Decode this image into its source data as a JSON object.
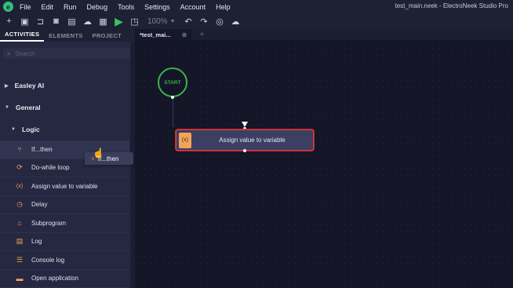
{
  "menu": {
    "logo_glyph": "e",
    "items": [
      "File",
      "Edit",
      "Run",
      "Debug",
      "Tools",
      "Settings",
      "Account",
      "Help"
    ],
    "window_title": "test_main.neek - ElectroNeek Studio Pro"
  },
  "toolbar": {
    "zoom_value": "100%",
    "icons": [
      "plus-icon",
      "save-icon",
      "folder-open-icon",
      "save-icon",
      "save-as-icon",
      "cloud-upload-icon",
      "ai-icon",
      "play-icon",
      "undo-icon",
      "redo-icon",
      "globe-icon",
      "cloud-icon"
    ]
  },
  "left_panel": {
    "tabs": [
      "ACTIVITIES",
      "ELEMENTS",
      "PROJECT"
    ],
    "active_tab": "ACTIVITIES",
    "search_placeholder": "Search",
    "groups": [
      {
        "label": "Easley AI",
        "expanded": false
      },
      {
        "label": "General",
        "expanded": true
      }
    ],
    "subgroup": {
      "label": "Logic",
      "expanded": true
    },
    "activities": [
      {
        "label": "If...then",
        "icon": "branch-icon",
        "glyph": "⑂"
      },
      {
        "label": "Do-while loop",
        "icon": "loop-icon",
        "glyph": "⟳"
      },
      {
        "label": "Assign value to variable",
        "icon": "variable-icon",
        "glyph": "(x)"
      },
      {
        "label": "Delay",
        "icon": "clock-icon",
        "glyph": "◷"
      },
      {
        "label": "Subprogram",
        "icon": "subprogram-icon",
        "glyph": "⌂"
      },
      {
        "label": "Log",
        "icon": "log-icon",
        "glyph": "▤"
      },
      {
        "label": "Console log",
        "icon": "console-icon",
        "glyph": "☰"
      },
      {
        "label": "Open application",
        "icon": "window-icon",
        "glyph": "▬"
      }
    ]
  },
  "drag_ghost": {
    "label": "If...then",
    "glyph": "⑂"
  },
  "editor": {
    "tab_label": "*test_mai...",
    "canvas": {
      "start_label": "START",
      "block_label": "Assign value to variable",
      "block_icon_glyph": "(x)"
    }
  },
  "colors": {
    "accent_orange": "#f2a45c",
    "start_green": "#3fb24a",
    "error_red": "#e5383b",
    "play_green": "#39c25f"
  }
}
